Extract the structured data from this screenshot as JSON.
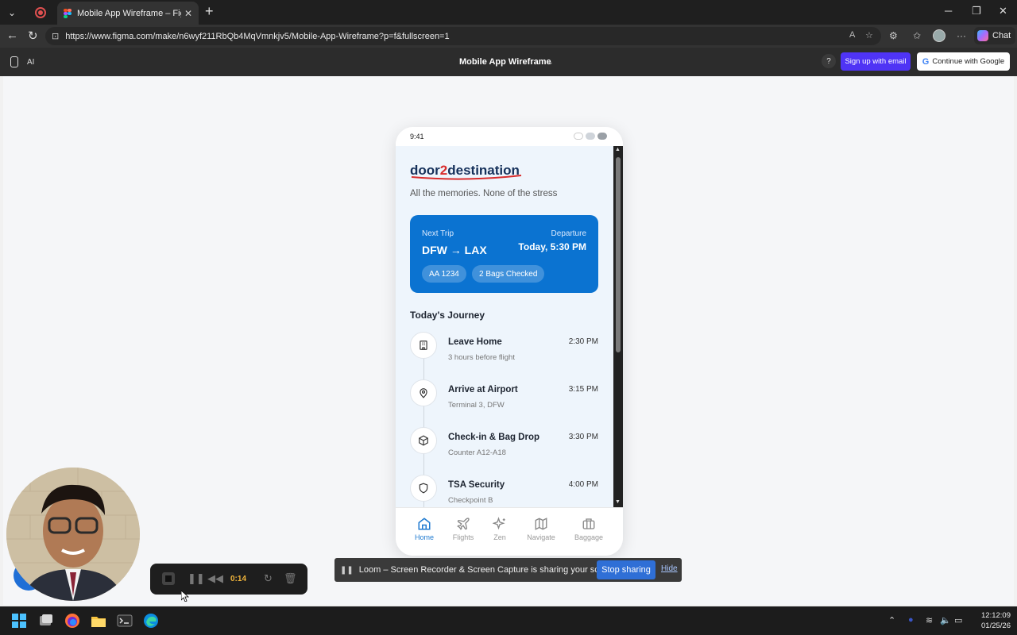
{
  "browser": {
    "tab_title": "Mobile App Wireframe – Figma M",
    "url": "https://www.figma.com/make/n6wyf211RbQb4MqVmnkjv5/Mobile-App-Wireframe?p=f&fullscreen=1",
    "chat_label": "Chat"
  },
  "figma": {
    "ai_label": "AI",
    "file_title": "Mobile App Wireframe",
    "help_label": "?",
    "signup_label": "Sign up with email",
    "google_label": "Continue with Google"
  },
  "app": {
    "status_time": "9:41",
    "logo_part1": "door",
    "logo_part2": "2",
    "logo_part3": "destination",
    "tagline": "All the memories. None of the stress",
    "trip": {
      "label": "Next Trip",
      "route": "DFW → LAX",
      "departure_label": "Departure",
      "departure_value": "Today, 5:30 PM",
      "flight_chip": "AA 1234",
      "bags_chip": "2 Bags Checked"
    },
    "journey_title": "Today's Journey",
    "journey": [
      {
        "title": "Leave Home",
        "subtitle": "3 hours before flight",
        "time": "2:30 PM",
        "icon": "building-icon"
      },
      {
        "title": "Arrive at Airport",
        "subtitle": "Terminal 3, DFW",
        "time": "3:15 PM",
        "icon": "map-pin-icon"
      },
      {
        "title": "Check-in & Bag Drop",
        "subtitle": "Counter A12-A18",
        "time": "3:30 PM",
        "icon": "package-icon"
      },
      {
        "title": "TSA Security",
        "subtitle": "Checkpoint B",
        "time": "4:00 PM",
        "icon": "shield-icon"
      }
    ],
    "nav": [
      {
        "label": "Home",
        "icon": "home-icon",
        "active": true
      },
      {
        "label": "Flights",
        "icon": "plane-icon",
        "active": false
      },
      {
        "label": "Zen",
        "icon": "sparkles-icon",
        "active": false
      },
      {
        "label": "Navigate",
        "icon": "map-icon",
        "active": false
      },
      {
        "label": "Baggage",
        "icon": "briefcase-icon",
        "active": false
      }
    ],
    "accent_color": "#0b73d1"
  },
  "loom": {
    "timer": "0:14",
    "share_text": "Loom – Screen Recorder & Screen Capture is sharing your screen.",
    "stop_label": "Stop sharing",
    "hide_label": "Hide"
  },
  "taskbar": {
    "time": "12:12:09",
    "date": "01/25/26"
  }
}
